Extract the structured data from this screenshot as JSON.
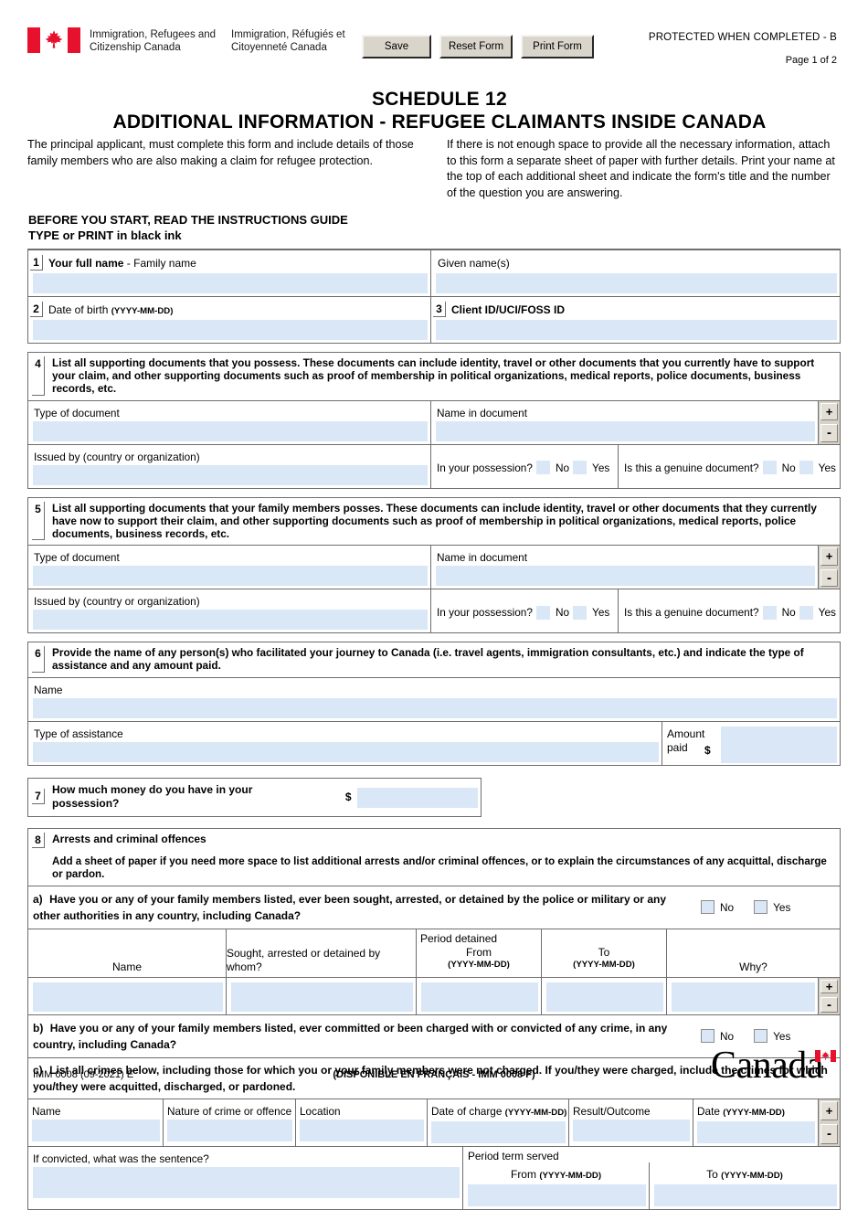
{
  "header": {
    "dept_en": "Immigration, Refugees and Citizenship Canada",
    "dept_fr": "Immigration, Réfugiés et Citoyenneté Canada",
    "save_label": "Save",
    "reset_label": "Reset Form",
    "print_label": "Print Form",
    "protected": "PROTECTED WHEN COMPLETED - B",
    "page_number": "Page 1 of 2"
  },
  "title": {
    "line1": "SCHEDULE 12",
    "line2": "ADDITIONAL INFORMATION - REFUGEE CLAIMANTS INSIDE CANADA"
  },
  "intro": {
    "left": "The principal applicant, must complete this form and include details of those family members who are also making a claim for refugee protection.",
    "right": "If there is not enough space to provide all the necessary information, attach to this form a separate sheet of paper with further details. Print your name at the top of each additional sheet and indicate the form's title and the number of the question you are answering."
  },
  "instructions": {
    "line1": "BEFORE YOU START, READ THE INSTRUCTIONS GUIDE",
    "line2_strong": "TYPE or PRINT",
    "line2_rest": " in black ink"
  },
  "q1": {
    "number": "1",
    "label_bold": "Your full name",
    "label_rest": " - Family name",
    "given_label": "Given name(s)",
    "family_value": "",
    "given_value": ""
  },
  "q2": {
    "number": "2",
    "label": "Date of birth ",
    "format": "(YYYY-MM-DD)",
    "value": ""
  },
  "q3": {
    "number": "3",
    "label": "Client ID/UCI/FOSS ID",
    "value": ""
  },
  "q4": {
    "number": "4",
    "text": "List all supporting documents that you possess. These documents can include identity, travel or other documents that you currently have to support your claim, and other supporting documents such as proof of membership in political organizations, medical reports, police documents, business records, etc.",
    "type_label": "Type of document",
    "type_value": "",
    "name_label": "Name in document",
    "name_value": "",
    "issued_label": "Issued by (country or organization)",
    "issued_value": "",
    "possession_label": "In your possession?",
    "genuine_label": "Is this a genuine document?",
    "no_label": "No",
    "yes_label": "Yes",
    "add_label": "+",
    "remove_label": "-"
  },
  "q5": {
    "number": "5",
    "text": "List all supporting documents that your family members posses. These documents can include identity, travel or other documents that they currently have now to support their claim, and other supporting documents such as proof of membership in political organizations, medical reports, police documents, business records, etc.",
    "type_label": "Type of document",
    "type_value": "",
    "name_label": "Name in document",
    "name_value": "",
    "issued_label": "Issued by (country or organization)",
    "issued_value": "",
    "possession_label": "In your possession?",
    "genuine_label": "Is this a genuine document?",
    "no_label": "No",
    "yes_label": "Yes",
    "add_label": "+",
    "remove_label": "-"
  },
  "q6": {
    "number": "6",
    "text": "Provide the name of any person(s) who facilitated your journey to Canada (i.e. travel agents, immigration consultants, etc.) and indicate the type of assistance and any amount paid.",
    "name_label": "Name",
    "name_value": "",
    "assistance_label": "Type of assistance",
    "assistance_value": "",
    "amount_label_1": "Amount",
    "amount_label_2": "paid",
    "currency": "$",
    "amount_value": ""
  },
  "q7": {
    "number": "7",
    "label": "How much money do you have in your possession?",
    "currency": "$",
    "value": ""
  },
  "q8": {
    "number": "8",
    "title": "Arrests and criminal offences",
    "note": "Add a sheet of paper if you need more space to list additional arrests and/or criminal offences, or to explain the circumstances of any acquittal, discharge or pardon.",
    "a": {
      "prefix": "a)",
      "text": "Have you or any of your family members listed, ever been sought, arrested, or detained by the police or military or any other authorities in any country, including Canada?",
      "no_label": "No",
      "yes_label": "Yes",
      "columns": [
        "Name",
        "Sought, arrested or detained by whom?",
        "Period detained",
        "From",
        "To",
        "Why?"
      ],
      "period_header": "Period detained",
      "from_header": "From",
      "to_header": "To",
      "date_format": "(YYYY-MM-DD)",
      "row": {
        "name": "",
        "by_whom": "",
        "from": "",
        "to": "",
        "why": ""
      },
      "add_label": "+",
      "remove_label": "-"
    },
    "b": {
      "prefix": "b)",
      "text": "Have you or any of your family members listed, ever committed or been charged with or convicted of any crime, in any country, including Canada?",
      "no_label": "No",
      "yes_label": "Yes"
    },
    "c": {
      "prefix": "c)",
      "text": "List all crimes below, including those for which you or your family members were not charged. If you/they were charged, include the crimes for which you/they were acquitted, discharged, or pardoned.",
      "col_name": "Name",
      "col_nature": "Nature of crime or offence",
      "col_location": "Location",
      "col_date_charge": "Date of charge ",
      "col_result": "Result/Outcome",
      "col_date": "Date ",
      "date_format": "(YYYY-MM-DD)",
      "row": {
        "name": "",
        "nature": "",
        "location": "",
        "date_of_charge": "",
        "result": "",
        "date": ""
      },
      "add_label": "+",
      "remove_label": "-",
      "sentence_label": "If convicted, what was the sentence?",
      "sentence_value": "",
      "period_term_label": "Period term served",
      "from_label": "From ",
      "to_label": "To ",
      "from_value": "",
      "to_value": ""
    }
  },
  "footer": {
    "form_code": "IMM 0008 (09-2021) E",
    "french_note": "(DISPONIBLE EN FRANÇAIS - IMM 0008 F)",
    "wordmark": "Canada"
  },
  "colors": {
    "field_fill": "#d9e7f7",
    "border": "#6e6e6e",
    "flag_red": "#e8112d",
    "button_face": "#d9d5cb"
  }
}
